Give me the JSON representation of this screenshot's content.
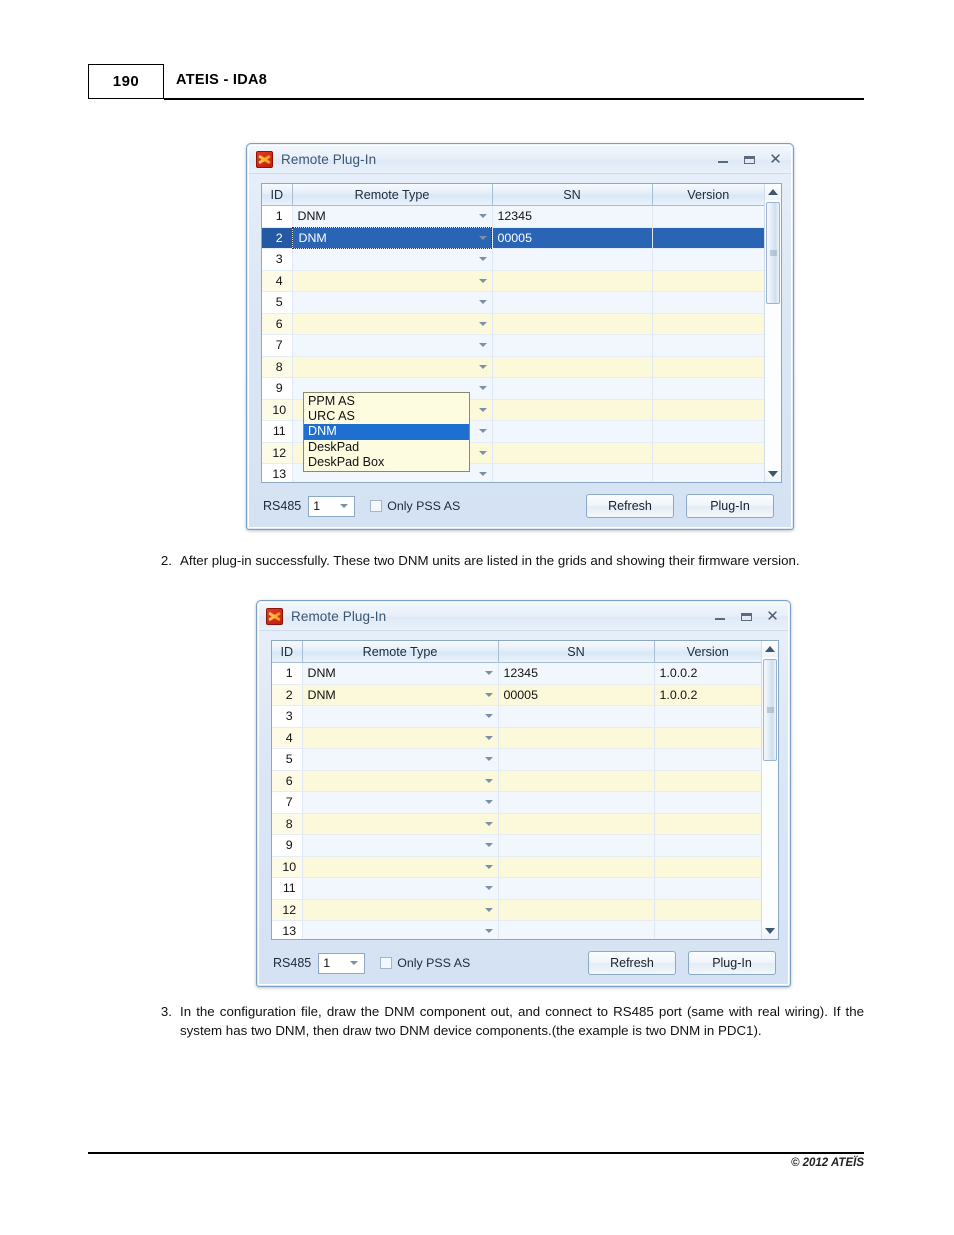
{
  "page": {
    "number": "190",
    "header_title": "ATEIS - IDA8",
    "footer_copyright": "© 2012 ATEÏS"
  },
  "paragraphs": [
    {
      "number": "2.",
      "text": "After plug-in successfully. These two DNM units are listed in the grids and showing their firmware version."
    },
    {
      "number": "3.",
      "text": "In the configuration file, draw the DNM component out, and connect to RS485 port (same with real wiring).  If the system has two DNM, then draw two DNM device components.(the example is two DNM in PDC1)."
    }
  ],
  "dialog1": {
    "title": "Remote Plug-In",
    "icon": "ateis-app-icon",
    "window_buttons": {
      "minimize": "minimize-icon",
      "maximize": "maximize-icon",
      "close": "close-icon"
    },
    "columns": [
      "ID",
      "Remote Type",
      "SN",
      "Version"
    ],
    "rows": [
      {
        "id": "1",
        "type": "DNM",
        "sn": "12345",
        "version": "",
        "state": "normal"
      },
      {
        "id": "2",
        "type": "DNM",
        "sn": "00005",
        "version": "",
        "state": "selected-editing"
      },
      {
        "id": "3",
        "type": "",
        "sn": "",
        "version": "",
        "state": "normal"
      },
      {
        "id": "4",
        "type": "",
        "sn": "",
        "version": "",
        "state": "normal"
      },
      {
        "id": "5",
        "type": "",
        "sn": "",
        "version": "",
        "state": "normal"
      },
      {
        "id": "6",
        "type": "",
        "sn": "",
        "version": "",
        "state": "normal"
      },
      {
        "id": "7",
        "type": "",
        "sn": "",
        "version": "",
        "state": "normal"
      },
      {
        "id": "8",
        "type": "",
        "sn": "",
        "version": "",
        "state": "normal"
      },
      {
        "id": "9",
        "type": "",
        "sn": "",
        "version": "",
        "state": "normal"
      },
      {
        "id": "10",
        "type": "",
        "sn": "",
        "version": "",
        "state": "normal"
      },
      {
        "id": "11",
        "type": "",
        "sn": "",
        "version": "",
        "state": "normal"
      },
      {
        "id": "12",
        "type": "",
        "sn": "",
        "version": "",
        "state": "normal"
      },
      {
        "id": "13",
        "type": "",
        "sn": "",
        "version": "",
        "state": "normal"
      }
    ],
    "dropdown": {
      "open": true,
      "editing_value": "DNM",
      "selected_option": "DNM",
      "options": [
        "PPM AS",
        "URC AS",
        "DNM",
        "DeskPad",
        "DeskPad Box"
      ]
    },
    "footer": {
      "rs485_label": "RS485",
      "rs485_value": "1",
      "checkbox_label": "Only PSS AS",
      "checkbox_checked": false,
      "refresh_label": "Refresh",
      "plugin_label": "Plug-In"
    }
  },
  "dialog2": {
    "title": "Remote Plug-In",
    "icon": "ateis-app-icon",
    "window_buttons": {
      "minimize": "minimize-icon",
      "maximize": "maximize-icon",
      "close": "close-icon"
    },
    "columns": [
      "ID",
      "Remote Type",
      "SN",
      "Version"
    ],
    "rows": [
      {
        "id": "1",
        "type": "DNM",
        "sn": "12345",
        "version": "1.0.0.2"
      },
      {
        "id": "2",
        "type": "DNM",
        "sn": "00005",
        "version": "1.0.0.2"
      },
      {
        "id": "3",
        "type": "",
        "sn": "",
        "version": ""
      },
      {
        "id": "4",
        "type": "",
        "sn": "",
        "version": ""
      },
      {
        "id": "5",
        "type": "",
        "sn": "",
        "version": ""
      },
      {
        "id": "6",
        "type": "",
        "sn": "",
        "version": ""
      },
      {
        "id": "7",
        "type": "",
        "sn": "",
        "version": ""
      },
      {
        "id": "8",
        "type": "",
        "sn": "",
        "version": ""
      },
      {
        "id": "9",
        "type": "",
        "sn": "",
        "version": ""
      },
      {
        "id": "10",
        "type": "",
        "sn": "",
        "version": ""
      },
      {
        "id": "11",
        "type": "",
        "sn": "",
        "version": ""
      },
      {
        "id": "12",
        "type": "",
        "sn": "",
        "version": ""
      },
      {
        "id": "13",
        "type": "",
        "sn": "",
        "version": ""
      }
    ],
    "footer": {
      "rs485_label": "RS485",
      "rs485_value": "1",
      "checkbox_label": "Only PSS AS",
      "checkbox_checked": false,
      "refresh_label": "Refresh",
      "plugin_label": "Plug-In"
    }
  },
  "colors": {
    "row_odd": "#f2f7fd",
    "row_even": "#fcf8da",
    "selection": "#2a64b4",
    "dialog_chrome": "#dbe7f5",
    "dropdown_bg": "#fdfbe0"
  }
}
